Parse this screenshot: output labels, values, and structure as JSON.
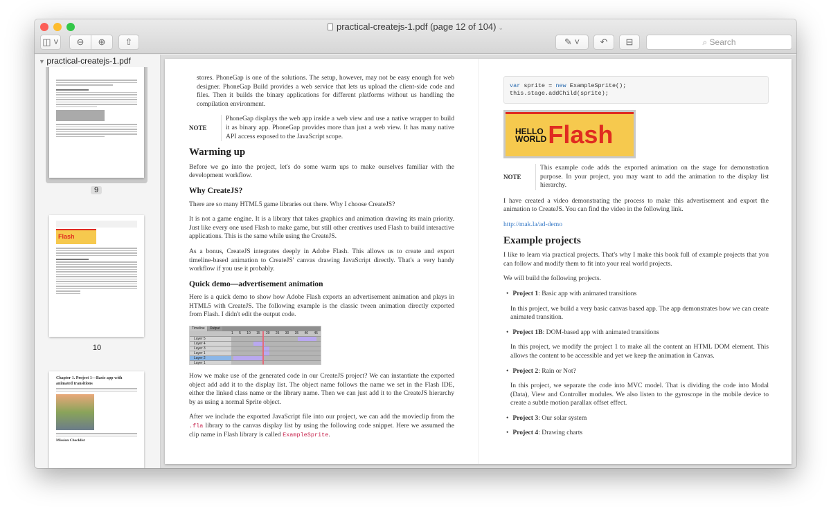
{
  "window": {
    "title": "practical-createjs-1.pdf (page 12 of 104)"
  },
  "toolbar": {
    "search_placeholder": "Search"
  },
  "sidebar": {
    "file": "practical-createjs-1.pdf",
    "pages": [
      {
        "label": "9"
      },
      {
        "label": "10"
      }
    ],
    "thumb11": {
      "heading": "Chapter 1. Project 1—Basic app with animated transitions",
      "sub": "Mission Checklist"
    },
    "thumb10": {
      "hello": "HELLO WORLD",
      "flash": "Flash"
    }
  },
  "left": {
    "p1": "stores. PhoneGap is one of the solutions. The setup, however, may not be easy enough for web designer. PhoneGap Build provides a web service that lets us upload the client-side code and files. Then it builds the binary applications for different platforms without us handling the compilation environment.",
    "note_label": "NOTE",
    "note": "PhoneGap displays the web app inside a web view and use a native wrapper to build it as binary app. PhoneGap provides more than just a web view. It has many native API access exposed to the JavaScript scope.",
    "h_warm": "Warming up",
    "p2": "Before we go into the project, let's do some warm ups to make ourselves familiar with the development workflow.",
    "h_why": "Why CreateJS?",
    "p3": "There are so many HTML5 game libraries out there. Why I choose CreateJS?",
    "p4": "It is not a game engine. It is a library that takes graphics and animation drawing its main priority. Just like every one used Flash to make game, but still other creatives used Flash to build interactive applications. This is the same while using the CreateJS.",
    "p5": "As a bonus, CreateJS integrates deeply in Adobe Flash. This allows us to create and export timeline-based animation to CreateJS' canvas drawing JavaScript directly. That's a very handy workflow if you use it probably.",
    "h_quick": "Quick demo—advertisement animation",
    "p6": "Here is a quick demo to show how Adobe Flash exports an advertisement animation and plays in HTML5 with CreateJS. The following example is the classic tween animation directly exported from Flash. I didn't edit the output code.",
    "timeline": {
      "tabs": [
        "Timeline",
        "Output"
      ],
      "layers": [
        "Layer 5",
        "Layer 4",
        "Layer 3",
        "Layer 1",
        "Layer 2",
        "Layer 1"
      ],
      "frames": [
        "1",
        "5",
        "10",
        "15",
        "20",
        "25",
        "30",
        "35",
        "40",
        "45"
      ]
    },
    "p7": "How we make use of the generated code in our CreateJS project? We can instantiate the exported object add add it to the display list. The object name follows the name we set in the Flash IDE, either the linked class name or the library name. Then we can just add it to the CreateJS hierarchy by as using a normal Sprite object.",
    "p8a": "After we include the exported JavaScript file into our project, we can add the movieclip from the ",
    "p8code": ".fla",
    "p8b": " library to the canvas display list by using the following code snippet. Here we assumed the clip name in Flash library is called ",
    "p8code2": "ExampleSprite",
    "p8c": "."
  },
  "right": {
    "code1_kw": "var",
    "code1_a": " sprite = ",
    "code1_kw2": "new",
    "code1_b": " ExampleSprite();",
    "code2": "this.stage.addChild(sprite);",
    "banner_hello": "HELLO",
    "banner_world": "WORLD",
    "banner_flash": "Flash",
    "note_label": "NOTE",
    "note": "This example code adds the exported animation on the stage for demonstration purpose. In your project, you may want to add the animation to the display list hierarchy.",
    "p1": "I have created a video demonstrating the process to make this advertisement and export the animation to CreateJS. You can find the video in the following link.",
    "link": "http://mak.la/ad-demo",
    "h_ex": "Example projects",
    "p2": "I like to learn via practical projects. That's why I make this book full of example projects that you can follow and modify them to fit into your real world projects.",
    "p3": "We will build the following projects.",
    "projects": [
      {
        "name": "Project 1",
        "title": ": Basic app with animated transitions",
        "desc": "In this project, we build a very basic canvas based app. The app demonstrates how we can create animated transition."
      },
      {
        "name": "Project 1B",
        "title": ": DOM-based app with animated transitions",
        "desc": "In this project, we modify the project 1 to make all the content an HTML DOM element. This allows the content to be accessible and yet we keep the animation in Canvas."
      },
      {
        "name": "Project 2",
        "title": ": Rain or Not?",
        "desc": "In this project, we separate the code into MVC model. That is dividing the code into Modal (Data), View and Controller modules. We also listen to the gyroscope in the mobile device to create a subtle motion parallax offset effect."
      },
      {
        "name": "Project 3",
        "title": ": Our solar system"
      },
      {
        "name": "Project 4",
        "title": ": Drawing charts"
      }
    ]
  }
}
